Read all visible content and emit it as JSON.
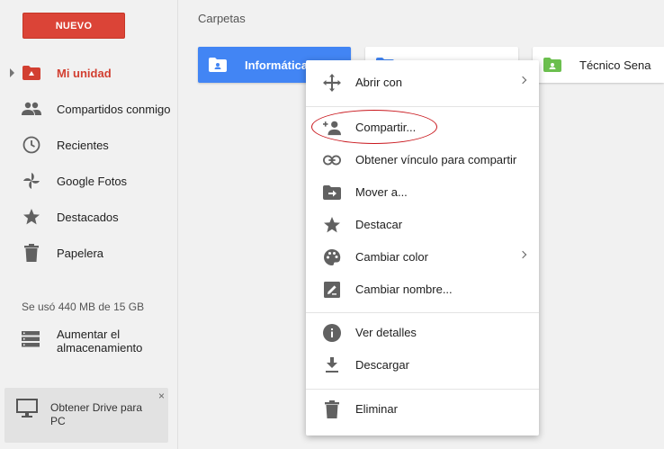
{
  "sidebar": {
    "new_button": "NUEVO",
    "items": [
      {
        "label": "Mi unidad",
        "icon": "drive-folder-icon",
        "active": true
      },
      {
        "label": "Compartidos conmigo",
        "icon": "people-icon"
      },
      {
        "label": "Recientes",
        "icon": "clock-icon"
      },
      {
        "label": "Google Fotos",
        "icon": "pinwheel-icon"
      },
      {
        "label": "Destacados",
        "icon": "star-icon"
      },
      {
        "label": "Papelera",
        "icon": "trash-icon"
      }
    ],
    "storage_text": "Se usó 440 MB de 15 GB",
    "upgrade_line1": "Aumentar el",
    "upgrade_line2": "almacenamiento",
    "promo_line1": "Obtener Drive para",
    "promo_line2": "PC",
    "promo_close": "×"
  },
  "main": {
    "section_title": "Carpetas",
    "folders": [
      {
        "name": "Informática",
        "color": "#ffffff",
        "selected": true
      },
      {
        "name": "",
        "color": "#4285f4"
      },
      {
        "name": "Técnico Sena",
        "color": "#6bbf4e"
      }
    ]
  },
  "context_menu": {
    "items": [
      {
        "label": "Abrir con",
        "icon": "move-arrows-icon",
        "submenu": true
      },
      {
        "label": "Compartir...",
        "icon": "add-person-icon"
      },
      {
        "label": "Obtener vínculo para compartir",
        "icon": "link-icon"
      },
      {
        "label": "Mover a...",
        "icon": "move-folder-icon"
      },
      {
        "label": "Destacar",
        "icon": "star-icon"
      },
      {
        "label": "Cambiar color",
        "icon": "palette-icon",
        "submenu": true
      },
      {
        "label": "Cambiar nombre...",
        "icon": "edit-icon"
      },
      {
        "label": "Ver detalles",
        "icon": "info-icon"
      },
      {
        "label": "Descargar",
        "icon": "download-icon"
      },
      {
        "label": "Eliminar",
        "icon": "trash-icon"
      }
    ]
  },
  "colors": {
    "accent_red": "#db4437",
    "selected_blue": "#4285f4",
    "highlight_ellipse": "#c9161c"
  }
}
